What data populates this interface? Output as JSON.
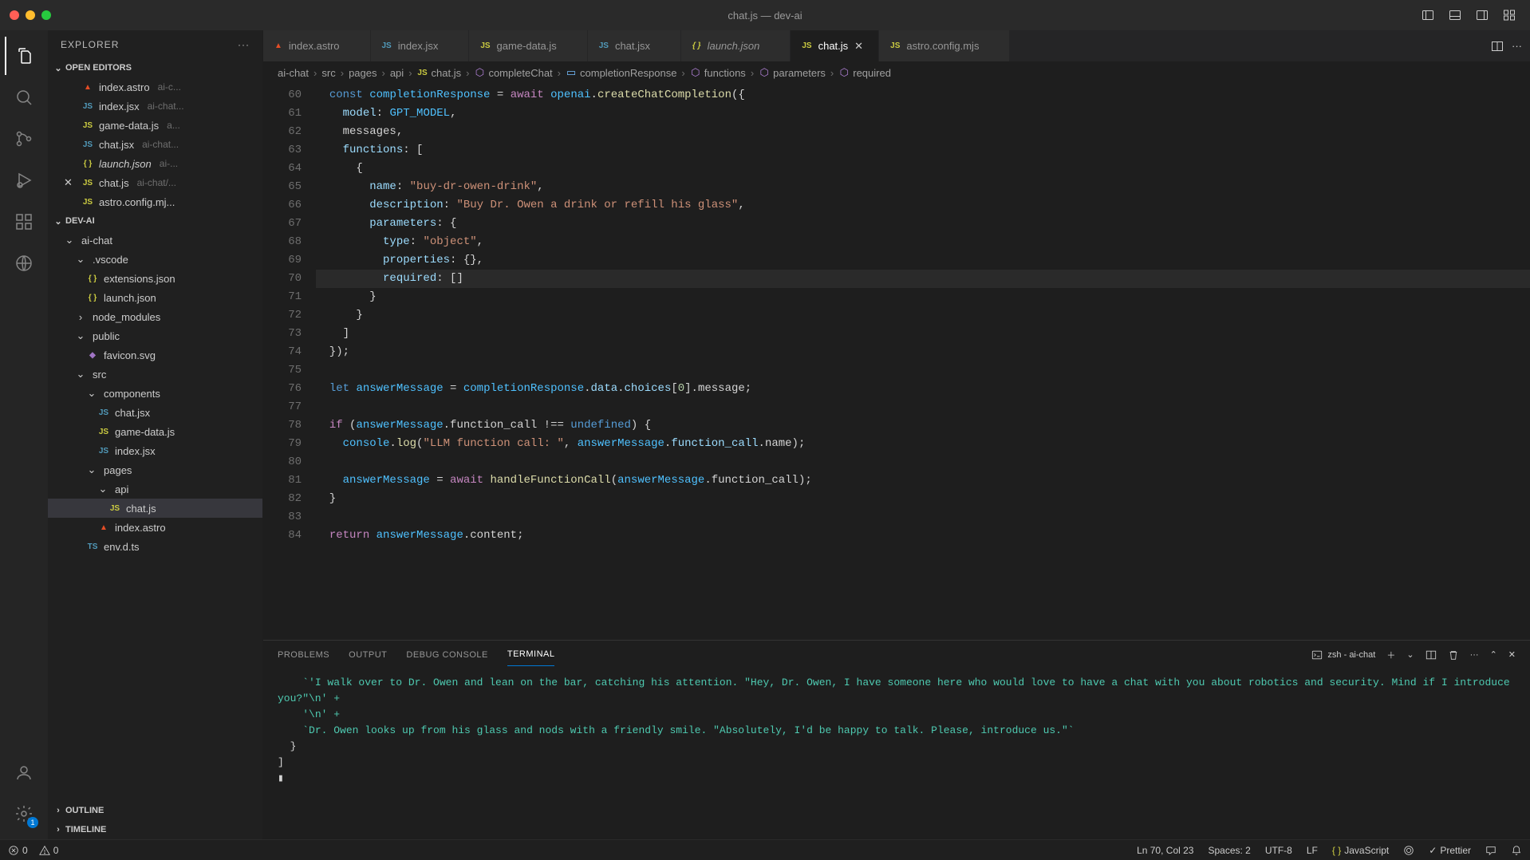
{
  "window": {
    "title": "chat.js — dev-ai"
  },
  "sidebar": {
    "title": "EXPLORER",
    "openEditors": {
      "label": "OPEN EDITORS",
      "items": [
        {
          "icon": "astro",
          "name": "index.astro",
          "hint": "ai-c..."
        },
        {
          "icon": "jsx",
          "name": "index.jsx",
          "hint": "ai-chat..."
        },
        {
          "icon": "js",
          "name": "game-data.js",
          "hint": "a..."
        },
        {
          "icon": "jsx",
          "name": "chat.jsx",
          "hint": "ai-chat..."
        },
        {
          "icon": "json",
          "name": "launch.json",
          "hint": "ai-...",
          "italic": true
        },
        {
          "icon": "js",
          "name": "chat.js",
          "hint": "ai-chat/...",
          "close": true
        },
        {
          "icon": "js",
          "name": "astro.config.mj...",
          "hint": ""
        }
      ]
    },
    "project": {
      "label": "DEV-AI",
      "tree": [
        {
          "depth": 0,
          "kind": "folder-open",
          "name": "ai-chat"
        },
        {
          "depth": 1,
          "kind": "folder-open",
          "name": ".vscode"
        },
        {
          "depth": 2,
          "kind": "file",
          "icon": "json",
          "name": "extensions.json"
        },
        {
          "depth": 2,
          "kind": "file",
          "icon": "json",
          "name": "launch.json"
        },
        {
          "depth": 1,
          "kind": "folder-closed",
          "name": "node_modules"
        },
        {
          "depth": 1,
          "kind": "folder-open",
          "name": "public"
        },
        {
          "depth": 2,
          "kind": "file",
          "icon": "svg",
          "name": "favicon.svg"
        },
        {
          "depth": 1,
          "kind": "folder-open",
          "name": "src"
        },
        {
          "depth": 2,
          "kind": "folder-open",
          "name": "components"
        },
        {
          "depth": 3,
          "kind": "file",
          "icon": "jsx",
          "name": "chat.jsx"
        },
        {
          "depth": 3,
          "kind": "file",
          "icon": "js",
          "name": "game-data.js"
        },
        {
          "depth": 3,
          "kind": "file",
          "icon": "jsx",
          "name": "index.jsx"
        },
        {
          "depth": 2,
          "kind": "folder-open",
          "name": "pages"
        },
        {
          "depth": 3,
          "kind": "folder-open",
          "name": "api"
        },
        {
          "depth": 4,
          "kind": "file",
          "icon": "js",
          "name": "chat.js",
          "selected": true
        },
        {
          "depth": 3,
          "kind": "file",
          "icon": "astro",
          "name": "index.astro"
        },
        {
          "depth": 2,
          "kind": "file",
          "icon": "ts",
          "name": "env.d.ts"
        }
      ]
    },
    "outline": "OUTLINE",
    "timeline": "TIMELINE"
  },
  "tabs": [
    {
      "icon": "astro",
      "label": "index.astro"
    },
    {
      "icon": "jsx",
      "label": "index.jsx"
    },
    {
      "icon": "js",
      "label": "game-data.js"
    },
    {
      "icon": "jsx",
      "label": "chat.jsx"
    },
    {
      "icon": "json",
      "label": "launch.json",
      "italic": true
    },
    {
      "icon": "js",
      "label": "chat.js",
      "active": true
    },
    {
      "icon": "js",
      "label": "astro.config.mjs"
    }
  ],
  "breadcrumbs": [
    {
      "label": "ai-chat"
    },
    {
      "label": "src"
    },
    {
      "label": "pages"
    },
    {
      "label": "api"
    },
    {
      "icon": "js",
      "label": "chat.js"
    },
    {
      "icon": "method",
      "label": "completeChat"
    },
    {
      "icon": "var",
      "label": "completionResponse"
    },
    {
      "icon": "method",
      "label": "functions"
    },
    {
      "icon": "method",
      "label": "parameters"
    },
    {
      "icon": "method",
      "label": "required"
    }
  ],
  "code": {
    "startLine": 60,
    "lines": [
      "  const completionResponse = await openai.createChatCompletion({",
      "    model: GPT_MODEL,",
      "    messages,",
      "    functions: [",
      "      {",
      "        name: \"buy-dr-owen-drink\",",
      "        description: \"Buy Dr. Owen a drink or refill his glass\",",
      "        parameters: {",
      "          type: \"object\",",
      "          properties: {},",
      "          required: []",
      "        }",
      "      }",
      "    ]",
      "  });",
      "",
      "  let answerMessage = completionResponse.data.choices[0].message;",
      "",
      "  if (answerMessage.function_call !== undefined) {",
      "    console.log(\"LLM function call: \", answerMessage.function_call.name);",
      "",
      "    answerMessage = await handleFunctionCall(answerMessage.function_call);",
      "  }",
      "",
      "  return answerMessage.content;"
    ]
  },
  "panel": {
    "tabs": {
      "problems": "PROBLEMS",
      "output": "OUTPUT",
      "debug": "DEBUG CONSOLE",
      "terminal": "TERMINAL"
    },
    "terminalName": "zsh - ai-chat",
    "terminalLines": [
      "    `'I walk over to Dr. Owen and lean on the bar, catching his attention. \"Hey, Dr. Owen, I have someone here who would love to have a chat with you about robotics and security. Mind if I introduce you?\"\\n' +",
      "    '\\n' +",
      "    `Dr. Owen looks up from his glass and nods with a friendly smile. \"Absolutely, I'd be happy to talk. Please, introduce us.\"`",
      "  }",
      "]",
      "▮"
    ]
  },
  "status": {
    "errors": "0",
    "warnings": "0",
    "lncol": "Ln 70, Col 23",
    "spaces": "Spaces: 2",
    "encoding": "UTF-8",
    "eol": "LF",
    "lang": "JavaScript",
    "prettier": "Prettier"
  },
  "settingsBadge": "1"
}
